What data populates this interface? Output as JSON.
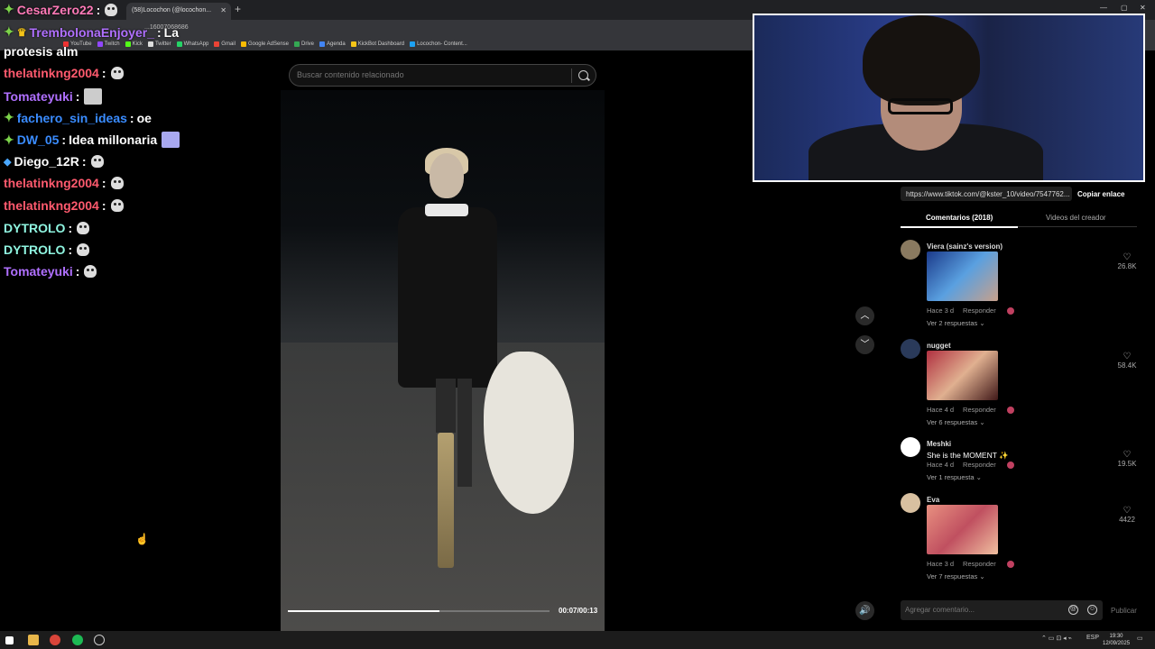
{
  "browser": {
    "tab_title": "(58)Locochon (@locochon...",
    "url": "...16007068686",
    "bookmarks": [
      "YouTube",
      "Twitch",
      "Kick",
      "Twitter",
      "WhatsApp",
      "Gmail",
      "Google AdSense",
      "Drive",
      "Agenda",
      "KickBot Dashboard",
      "Locochon- Content..."
    ]
  },
  "chat": [
    {
      "user": "CesarZero22",
      "color": "#ff7ab8",
      "msg": ""
    },
    {
      "user": "TrembolonaEnjoyer_",
      "color": "#b070ff",
      "msg": "La"
    },
    {
      "user": "",
      "color": "#ffffff",
      "msg": "protesis alm"
    },
    {
      "user": "thelatinkng2004",
      "color": "#ff5a6e",
      "msg": ""
    },
    {
      "user": "Tomateyuki",
      "color": "#b070ff",
      "msg": ""
    },
    {
      "user": "fachero_sin_ideas",
      "color": "#3a8cff",
      "msg": "oe"
    },
    {
      "user": "DW_05",
      "color": "#3a8cff",
      "msg": "Idea millonaria"
    },
    {
      "user": "Diego_12R",
      "color": "#ffffff",
      "msg": ""
    },
    {
      "user": "thelatinkng2004",
      "color": "#ff5a6e",
      "msg": ""
    },
    {
      "user": "thelatinkng2004",
      "color": "#ff5a6e",
      "msg": ""
    },
    {
      "user": "DYTROLO",
      "color": "#8ff5e0",
      "msg": ""
    },
    {
      "user": "DYTROLO",
      "color": "#8ff5e0",
      "msg": ""
    },
    {
      "user": "Tomateyuki",
      "color": "#b070ff",
      "msg": ""
    }
  ],
  "search": {
    "placeholder": "Buscar contenido relacionado"
  },
  "video": {
    "time": "00:07/00:13",
    "progress": 0.58
  },
  "link": {
    "url": "https://www.tiktok.com/@kster_10/video/7547762...",
    "copy_label": "Copiar enlace"
  },
  "tabs": {
    "comments": "Comentarios (2018)",
    "creator_videos": "Videos del creador"
  },
  "comments": [
    {
      "user": "Viera (sainz's version)",
      "text": "",
      "has_media": true,
      "meta_time": "Hace 3 d",
      "reply": "Responder",
      "replies": "Ver 2 respuestas",
      "likes": "26.8K"
    },
    {
      "user": "nugget",
      "text": "",
      "has_media": true,
      "meta_time": "Hace 4 d",
      "reply": "Responder",
      "replies": "Ver 6 respuestas",
      "likes": "58.4K"
    },
    {
      "user": "Meshki",
      "text": "She is the MOMENT ✨",
      "has_media": false,
      "meta_time": "Hace 4 d",
      "reply": "Responder",
      "replies": "Ver 1 respuesta",
      "likes": "19.5K"
    },
    {
      "user": "Eva",
      "text": "",
      "has_media": true,
      "meta_time": "Hace 3 d",
      "reply": "Responder",
      "replies": "Ver 7 respuestas",
      "likes": "4422"
    }
  ],
  "comment_input": {
    "placeholder": "Agregar comentario...",
    "publish": "Publicar"
  },
  "taskbar": {
    "lang": "ESP",
    "time": "19:30",
    "date": "12/09/2025"
  }
}
